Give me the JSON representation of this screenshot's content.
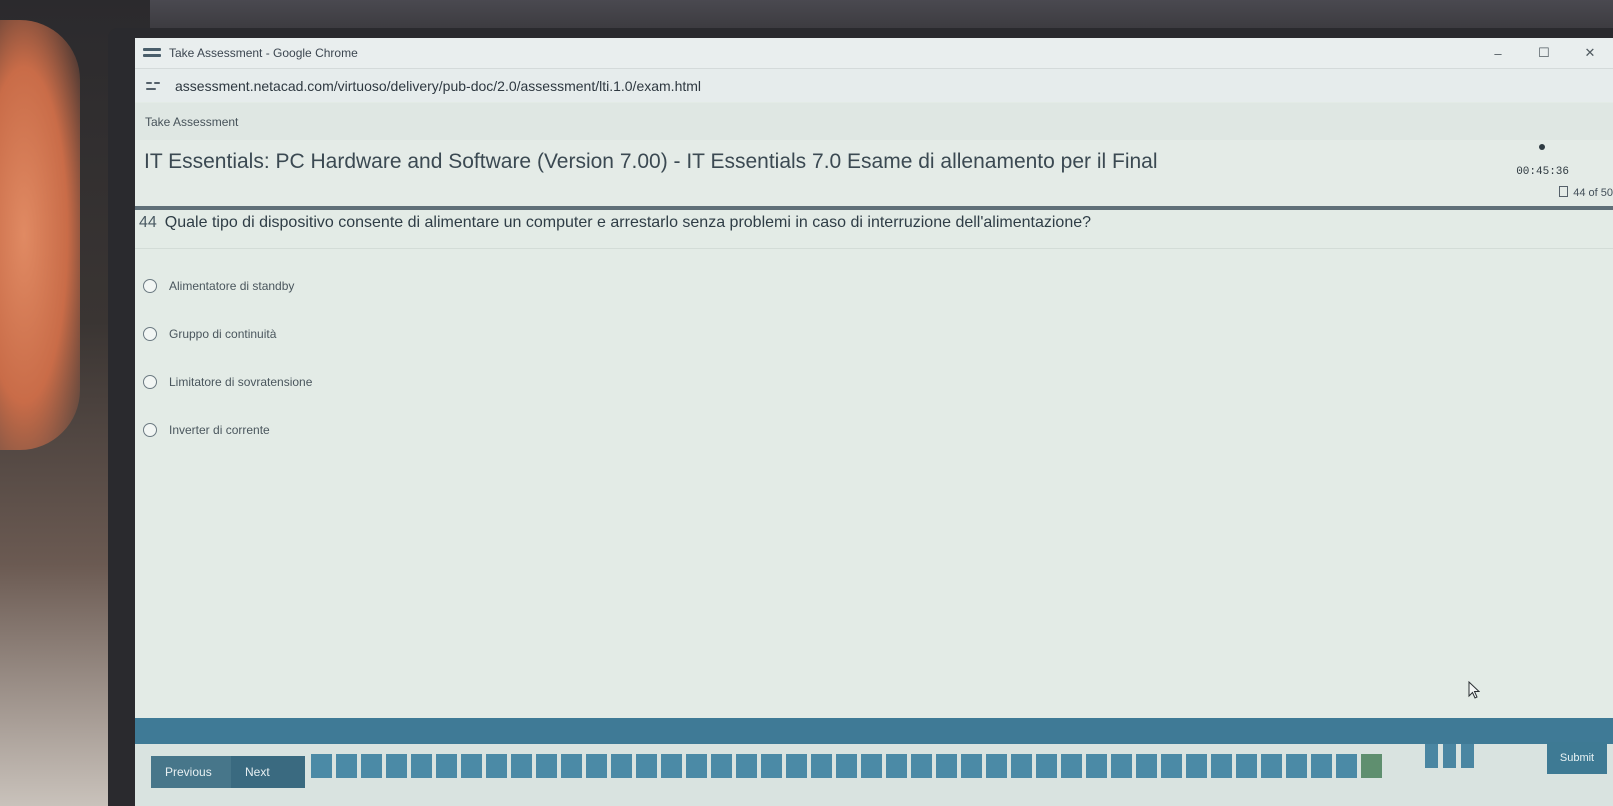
{
  "window": {
    "title": "Take Assessment - Google Chrome",
    "controls": {
      "minimize": "–",
      "maximize": "☐",
      "close": "✕"
    }
  },
  "address_bar": {
    "url": "assessment.netacad.com/virtuoso/delivery/pub-doc/2.0/assessment/lti.1.0/exam.html"
  },
  "page": {
    "label": "Take Assessment"
  },
  "exam": {
    "title": "IT Essentials: PC Hardware and Software (Version 7.00) - IT Essentials 7.0 Esame di allenamento per il Final",
    "timer": "00:45:36",
    "progress": "44 of 50",
    "current_question": 44,
    "total_questions": 50
  },
  "question": {
    "number": "44",
    "text": "Quale tipo di dispositivo consente di alimentare un computer e arrestarlo senza problemi in caso di interruzione dell'alimentazione?",
    "answers": [
      {
        "label": "Alimentatore di standby",
        "selected": false
      },
      {
        "label": "Gruppo di continuità",
        "selected": false
      },
      {
        "label": "Limitatore di sovratensione",
        "selected": false
      },
      {
        "label": "Inverter di corrente",
        "selected": false
      }
    ]
  },
  "footer": {
    "previous_label": "Previous",
    "next_label": "Next",
    "submit_label": "Submit"
  },
  "colors": {
    "accent": "#3f7a96",
    "nav_square": "#4b8aa6",
    "background": "#e3ebe6"
  },
  "icons": {
    "app": "chrome-window-icon",
    "site": "site-settings-icon",
    "timer": "clock-icon",
    "progress": "bookmark-icon",
    "answer": "radio-icon"
  }
}
